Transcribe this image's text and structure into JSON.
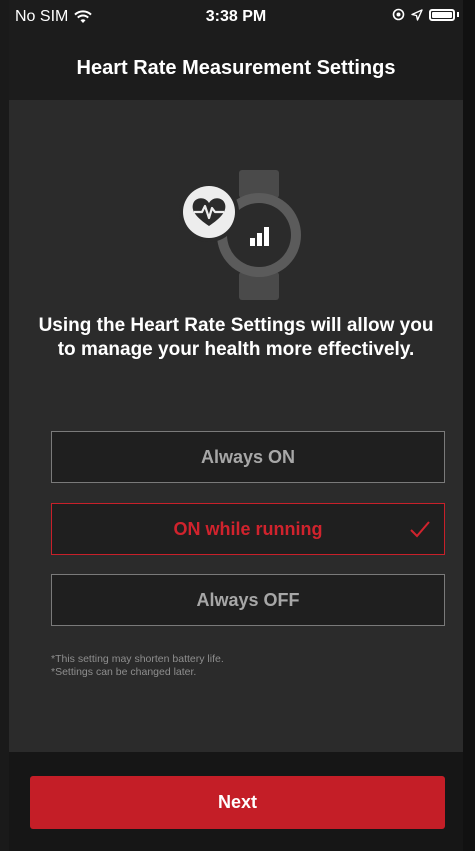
{
  "status_bar": {
    "carrier": "No SIM",
    "time": "3:38 PM"
  },
  "header": {
    "title": "Heart Rate Measurement Settings"
  },
  "hero": {
    "icons": [
      "heart-rate-icon",
      "watch-icon",
      "bar-chart-icon"
    ]
  },
  "main": {
    "headline": "Using the Heart Rate Settings will allow you to manage your health more effectively.",
    "options": [
      {
        "label": "Always ON",
        "selected": false
      },
      {
        "label": "ON while running",
        "selected": true
      },
      {
        "label": "Always OFF",
        "selected": false
      }
    ],
    "notes": [
      "*This setting may shorten battery life.",
      "*Settings can be changed later."
    ]
  },
  "footer": {
    "next_label": "Next"
  },
  "colors": {
    "accent": "#c41e27",
    "selected_text": "#d0232d",
    "background": "#2b2b2b",
    "option_text": "#a7a7a7"
  }
}
